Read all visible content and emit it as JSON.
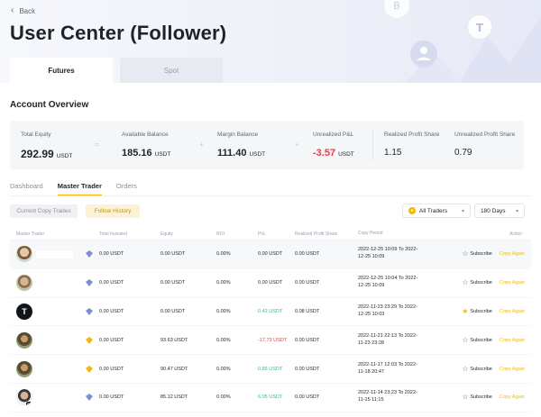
{
  "header": {
    "back_label": "Back",
    "title": "User Center (Follower)"
  },
  "market_tabs": [
    {
      "label": "Futures",
      "active": true
    },
    {
      "label": "Spot",
      "active": false
    }
  ],
  "overview": {
    "title": "Account Overview",
    "total_equity": {
      "label": "Total Equity",
      "value": "292.99",
      "unit": "USDT"
    },
    "available_balance": {
      "label": "Available Balance",
      "value": "185.16",
      "unit": "USDT"
    },
    "margin_balance": {
      "label": "Margin Balance",
      "value": "111.40",
      "unit": "USDT"
    },
    "unrealized_pnl": {
      "label": "Unrealized P&L",
      "value": "-3.57",
      "unit": "USDT"
    },
    "realized_profit_share": {
      "label": "Realized Profit Share",
      "value": "1.15"
    },
    "unrealized_profit_share": {
      "label": "Unrealized Profit Share",
      "value": "0.79"
    },
    "operators": [
      "=",
      "+",
      "+"
    ]
  },
  "sub_tabs": [
    {
      "label": "Dashboard"
    },
    {
      "label": "Master Trader",
      "active": true
    },
    {
      "label": "Orders"
    }
  ],
  "filters": {
    "current_copy_trades": "Current Copy Trades",
    "follow_history": "Follow History",
    "traders_select": "All Traders",
    "days_select": "180 Days"
  },
  "table": {
    "columns": [
      "Master Trader",
      "Total Invested",
      "Equity",
      "ROI",
      "PnL",
      "Realized Profit Share",
      "Copy Period",
      "Action"
    ],
    "subscribe_label": "Subscribe",
    "copy_again_label": "Copy Again",
    "rows": [
      {
        "invested": "0.00 USDT",
        "equity": "0.00 USDT",
        "roi": "0.00%",
        "pnl": "0.00 USDT",
        "pnl_sign": "zero",
        "share": "0.00 USDT",
        "period_start": "2022-12-25 10:09 To 2022-",
        "period_end": "12-25 10:09",
        "subscribed": false
      },
      {
        "invested": "0.00 USDT",
        "equity": "0.00 USDT",
        "roi": "0.00%",
        "pnl": "0.00 USDT",
        "pnl_sign": "zero",
        "share": "0.00 USDT",
        "period_start": "2022-12-25 10:04 To 2022-",
        "period_end": "12-25 10:09",
        "subscribed": false
      },
      {
        "invested": "0.00 USDT",
        "equity": "0.00 USDT",
        "roi": "0.00%",
        "pnl": "0.42 USDT",
        "pnl_sign": "pos",
        "share": "0.08 USDT",
        "period_start": "2022-11-23 23:29 To 2022-",
        "period_end": "12-25 10:03",
        "subscribed": true
      },
      {
        "invested": "0.00 USDT",
        "equity": "93.63 USDT",
        "roi": "0.00%",
        "pnl": "-17.73 USDT",
        "pnl_sign": "neg",
        "share": "0.00 USDT",
        "period_start": "2022-11-21 22:13 To 2022-",
        "period_end": "11-23 23:28",
        "subscribed": false
      },
      {
        "invested": "0.00 USDT",
        "equity": "90.47 USDT",
        "roi": "0.00%",
        "pnl": "0.85 USDT",
        "pnl_sign": "pos",
        "share": "0.00 USDT",
        "period_start": "2022-11-17 12:03 To 2022-",
        "period_end": "11-18 20:47",
        "subscribed": false
      },
      {
        "invested": "0.00 USDT",
        "equity": "85.12 USDT",
        "roi": "0.00%",
        "pnl": "6.05 USDT",
        "pnl_sign": "pos",
        "share": "0.00 USDT",
        "period_start": "2022-11-14 23:23 To 2022-",
        "period_end": "11-15 11:15",
        "subscribed": false
      }
    ]
  },
  "row_avatars": [
    {
      "kind": "face1",
      "badge": "blue-icon"
    },
    {
      "kind": "face2",
      "badge": "blue-icon"
    },
    {
      "kind": "t-logo",
      "letter": "T",
      "badge": "blue-icon"
    },
    {
      "kind": "soldier",
      "badge": "gold-icon"
    },
    {
      "kind": "soldier",
      "badge": "gold-icon"
    },
    {
      "kind": "au",
      "label": "AU",
      "badge": "blue-icon"
    }
  ],
  "colors": {
    "accent": "#f0b90b",
    "positive": "#2ebd85",
    "negative": "#e0424a"
  }
}
